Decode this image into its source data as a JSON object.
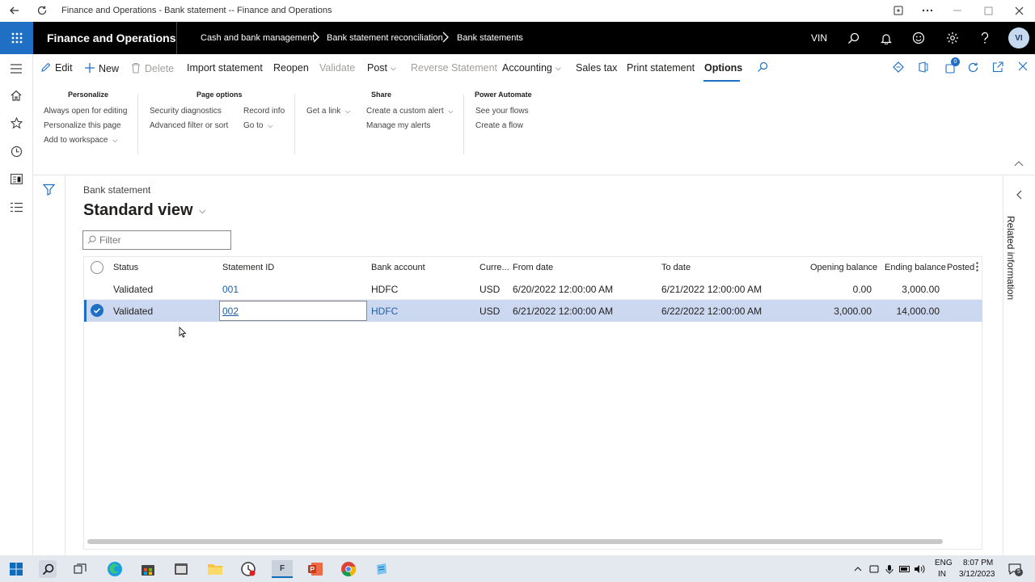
{
  "browser": {
    "title": "Finance and Operations - Bank statement -- Finance and Operations"
  },
  "header": {
    "app_name": "Finance and Operations",
    "breadcrumbs": [
      "Cash and bank management",
      "Bank statement reconciliation",
      "Bank statements"
    ],
    "company": "VIN",
    "avatar_initials": "VI"
  },
  "actions": {
    "edit": "Edit",
    "new": "New",
    "delete": "Delete",
    "import_statement": "Import statement",
    "reopen": "Reopen",
    "validate": "Validate",
    "post": "Post",
    "reverse_statement": "Reverse Statement",
    "accounting": "Accounting",
    "sales_tax": "Sales tax",
    "print_statement": "Print statement",
    "options": "Options"
  },
  "options_groups": {
    "personalize": {
      "title": "Personalize",
      "items": [
        "Always open for editing",
        "Personalize this page",
        "Add to workspace"
      ]
    },
    "page_options": {
      "title": "Page options",
      "items": [
        "Security diagnostics",
        "Advanced filter or sort",
        "Record info",
        "Go to"
      ]
    },
    "share": {
      "title": "Share",
      "items": [
        "Get a link",
        "Create a custom alert",
        "Manage my alerts"
      ]
    },
    "power_automate": {
      "title": "Power Automate",
      "items": [
        "See your flows",
        "Create a flow"
      ]
    }
  },
  "notification_count": "0",
  "page": {
    "entity": "Bank statement",
    "view_name": "Standard view",
    "filter_placeholder": "Filter"
  },
  "grid": {
    "columns": [
      "Status",
      "Statement ID",
      "Bank account",
      "Curre...",
      "From date",
      "To date",
      "Opening balance",
      "Ending balance",
      "Posted"
    ],
    "rows": [
      {
        "status": "Validated",
        "statement_id": "001",
        "bank_account": "HDFC",
        "currency": "USD",
        "from_date": "6/20/2022 12:00:00 AM",
        "to_date": "6/21/2022 12:00:00 AM",
        "opening_balance": "0.00",
        "ending_balance": "3,000.00",
        "selected": false
      },
      {
        "status": "Validated",
        "statement_id": "002",
        "bank_account": "HDFC",
        "currency": "USD",
        "from_date": "6/21/2022 12:00:00 AM",
        "to_date": "6/22/2022 12:00:00 AM",
        "opening_balance": "3,000.00",
        "ending_balance": "14,000.00",
        "selected": true
      }
    ]
  },
  "related_information": "Related information",
  "taskbar": {
    "app_letter": "F",
    "language": "ENG",
    "region": "IN",
    "time": "8:07 PM",
    "date": "3/12/2023",
    "notification_badge": "5"
  },
  "colors": {
    "accent": "#1f6fc5",
    "header_bg": "#000000",
    "selected_row": "#ccd8ef",
    "link": "#1f5fa6"
  }
}
